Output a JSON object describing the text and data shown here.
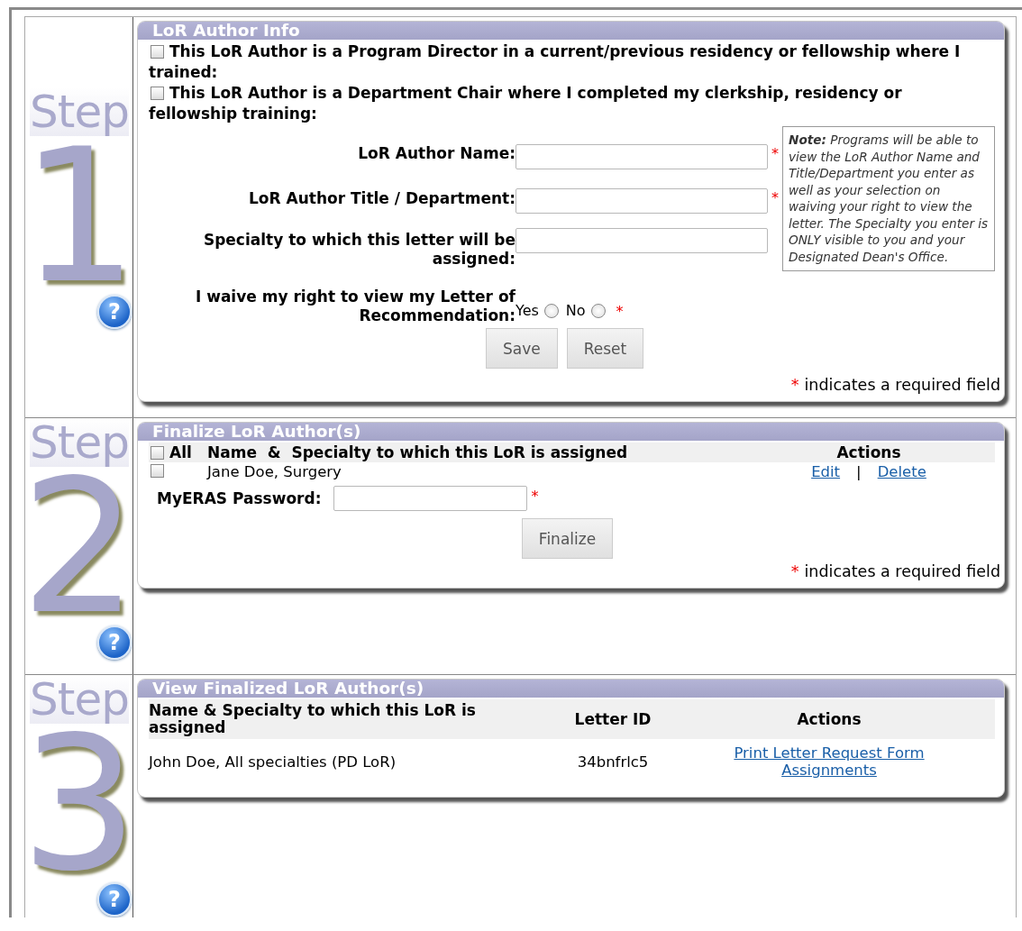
{
  "steps": [
    {
      "label": "Step",
      "number": "1",
      "help": "?"
    },
    {
      "label": "Step",
      "number": "2",
      "help": "?"
    },
    {
      "label": "Step",
      "number": "3",
      "help": "?"
    }
  ],
  "author_info": {
    "title": "LoR Author Info",
    "checkboxes": [
      {
        "label": "This LoR Author is a Program Director in a current/previous residency or fellowship where I trained:",
        "checked": false
      },
      {
        "label": "This LoR Author is a Department Chair where I completed my clerkship, residency or fellowship training:",
        "checked": false
      }
    ],
    "fields": [
      {
        "label": "LoR Author Name:",
        "required_mark": "*"
      },
      {
        "label": "LoR Author Title / Department:",
        "required_mark": "*"
      },
      {
        "label": "Specialty to which this letter will be assigned:"
      }
    ],
    "note": "**Note:** Programs will be able to view the LoR Author Name and Title/Department you enter as well as your selection on waiving your right to view the letter. The Specialty you enter is ONLY visible to you and your Designated Dean's Office.",
    "waive": {
      "label": "I waive my right to view my Letter of Recommendation:",
      "options": [
        {
          "label": "Yes",
          "selected": false
        },
        {
          "label": "No",
          "selected": false
        }
      ],
      "required_mark": "*"
    },
    "buttons": [
      "Save",
      "Reset"
    ],
    "legend": {
      "mark": "*",
      "text": "indicates a required field"
    }
  },
  "finalize": {
    "title": "Finalize LoR Author(s)",
    "header": {
      "all_label": "All",
      "all_checked": false,
      "name": "Name  &  Specialty to which this LoR is assigned",
      "actions": "Actions"
    },
    "rows": [
      {
        "name": "Jane Doe, Surgery",
        "checked": false,
        "actions": [
          "Edit",
          "Delete"
        ],
        "separator": "|"
      }
    ],
    "password": {
      "label": "MyERAS Password:",
      "required_mark": "*"
    },
    "button": "Finalize",
    "legend": {
      "mark": "*",
      "text": "indicates a required field"
    }
  },
  "finalized": {
    "title": "View Finalized LoR Author(s)",
    "columns": [
      "Name & Specialty to which this LoR is assigned",
      "Letter ID",
      "Actions"
    ],
    "rows": [
      {
        "name": "John Doe, All specialties (PD LoR)",
        "letter_id": "34bnfrlc5",
        "action": "Print Letter Request Form Assignments"
      }
    ]
  }
}
